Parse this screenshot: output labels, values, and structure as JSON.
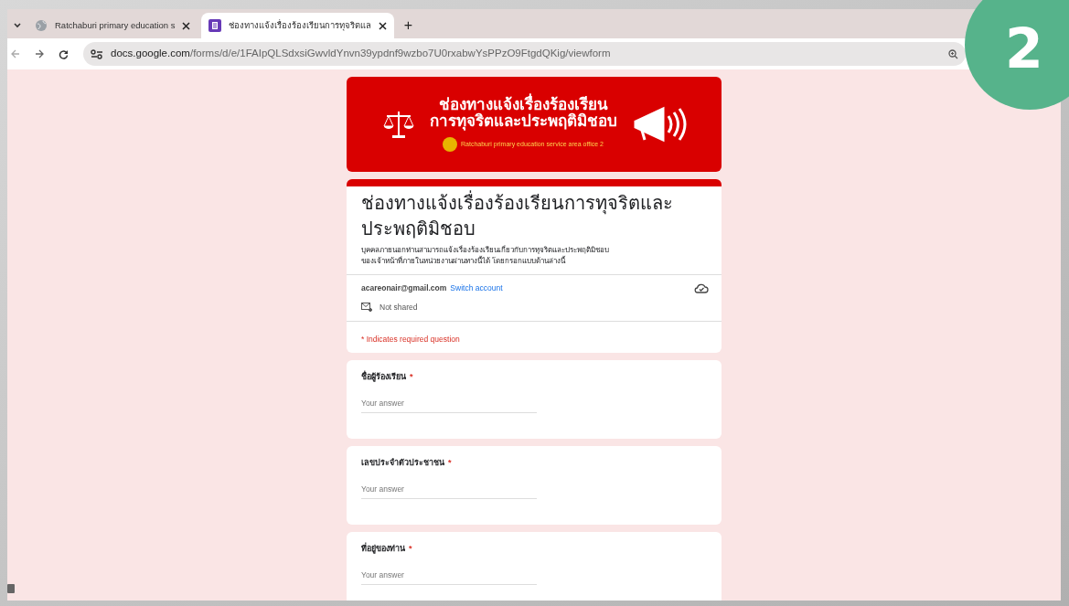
{
  "browser": {
    "tabs": [
      {
        "title": "Ratchaburi primary education s",
        "selected": false
      },
      {
        "title": "ช่องทางแจ้งเรื่องร้องเรียนการทุจริตแล",
        "selected": true
      }
    ],
    "new_tab": "+",
    "url_host": "docs.google.com",
    "url_path": "/forms/d/e/1FAIpQLSdxsiGwvldYnvn39ypdnf9wzbo7U0rxabwYsPPzO9FtgdQKig/viewform"
  },
  "banner": {
    "title_lines": [
      "ช่องทางแจ้งเรื่องร้องเรียน",
      "การทุจริตและประพฤติมิชอบ"
    ],
    "org_english": "Ratchaburi primary education service area office 2"
  },
  "form": {
    "title": "ช่องทางแจ้งเรื่องร้องเรียนการทุจริตและประพฤติมิชอบ",
    "description_lines": [
      "บุคคลภายนอกท่านสามารถแจ้งเรื่องร้องเรียนเกี่ยวกับการทุจริตและประพฤติมิชอบ",
      "ของเจ้าหน้าที่ภายในหน่วยงานผ่านทางนี้ได้ โดยกรอกแบบด้านล่างนี้"
    ],
    "email": "acareonair@gmail.com",
    "switch_account": "Switch account",
    "sharing": "Not shared",
    "required_note": "* Indicates required question"
  },
  "questions": [
    {
      "label": "ชื่อผู้ร้องเรียน",
      "required": true,
      "placeholder": "Your answer"
    },
    {
      "label": "เลขประจำตัวประชาชน",
      "required": true,
      "placeholder": "Your answer"
    },
    {
      "label": "ที่อยู่ของท่าน",
      "required": true,
      "placeholder": "Your answer"
    }
  ],
  "required_mark": "*",
  "step_badge": "2"
}
